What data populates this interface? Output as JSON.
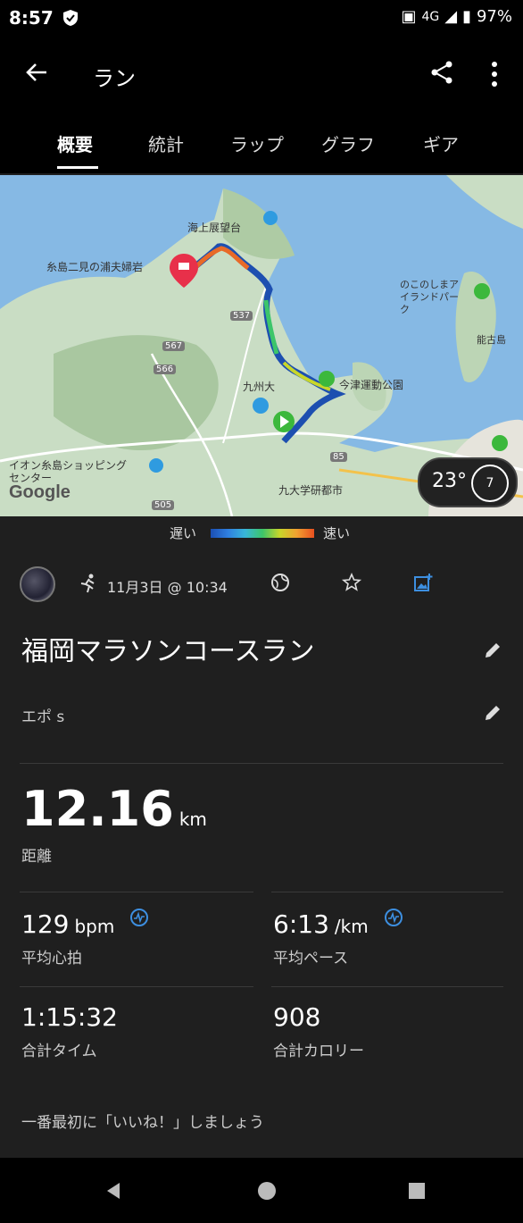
{
  "status": {
    "time": "8:57",
    "network": "4G",
    "battery": "97%"
  },
  "appbar": {
    "title": "ラン"
  },
  "tabs": [
    "概要",
    "統計",
    "ラップ",
    "グラフ",
    "ギア"
  ],
  "map": {
    "labels": [
      "海上展望台",
      "糸島二見の浦夫婦岩",
      "のこのしまアイランドパーク",
      "能古島",
      "今津運動公園",
      "九州大",
      "イオン糸島ショッピングセンター",
      "九大学研都市",
      "Google"
    ],
    "road_numbers": [
      "537",
      "567",
      "566",
      "85",
      "505"
    ],
    "weather": {
      "temp": "23°",
      "wind": "7"
    }
  },
  "legend": {
    "slow": "遅い",
    "fast": "速い",
    "colors": [
      "#1b4fb3",
      "#2f7fe0",
      "#38b6d8",
      "#3cc56a",
      "#c8d62a",
      "#f0a030",
      "#e85020"
    ]
  },
  "activity": {
    "date": "11月3日 @ 10:34",
    "title": "福岡マラソンコースラン",
    "device": "エポ s"
  },
  "stats": {
    "distance": {
      "value": "12.16",
      "unit": "km",
      "label": "距離"
    },
    "heart_rate": {
      "value": "129",
      "unit": "bpm",
      "label": "平均心拍"
    },
    "pace": {
      "value": "6:13",
      "unit": "/km",
      "label": "平均ペース"
    },
    "time": {
      "value": "1:15:32",
      "label": "合計タイム"
    },
    "calories": {
      "value": "908",
      "label": "合計カロリー"
    }
  },
  "like_prompt": "一番最初に「いいね！」しましょう"
}
